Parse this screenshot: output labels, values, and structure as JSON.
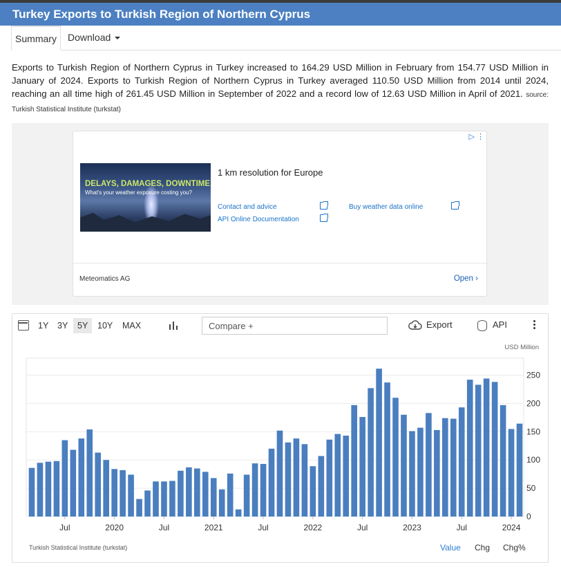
{
  "page": {
    "title": "Turkey Exports to Turkish Region of Northern Cyprus",
    "tabs": [
      {
        "label": "Summary"
      },
      {
        "label": "Download"
      }
    ],
    "description": "Exports to Turkish Region of Northern Cyprus in Turkey increased to 164.29 USD Million in February from 154.77 USD Million in January of 2024. Exports to Turkish Region of Northern Cyprus in Turkey averaged 110.50 USD Million from 2014 until 2024, reaching an all time high of 261.45 USD Million in September of 2022 and a record low of 12.63 USD Million in April of 2021.",
    "source_note": "source: Turkish Statistical Institute (turkstat)"
  },
  "ad": {
    "image_headline": "DELAYS, DAMAGES, DOWNTIME",
    "image_subline": "What's your weather exposure costing you?",
    "headline": "1 km resolution for Europe",
    "link1": "Contact and advice",
    "link2": "Buy weather data online",
    "link3": "API Online Documentation",
    "company": "Meteomatics AG",
    "open_label": "Open",
    "open_chevron": "›",
    "corner_icons": "▷ ⋮"
  },
  "toolbar": {
    "ranges": [
      "1Y",
      "3Y",
      "5Y",
      "10Y",
      "MAX"
    ],
    "selected_range": "5Y",
    "compare_placeholder": "Compare +",
    "export_label": "Export",
    "api_label": "API"
  },
  "footer": {
    "source": "Turkish Statistical Institute (turkstat)",
    "buttons": [
      "Value",
      "Chg",
      "Chg%"
    ],
    "active": "Value"
  },
  "colors": {
    "bar": "#4a7ebf",
    "title_bg": "#4c80c2",
    "active_link": "#2d7dd2"
  },
  "chart_data": {
    "type": "bar",
    "unit_label": "USD Million",
    "ylim": [
      0,
      280
    ],
    "yticks": [
      0,
      50,
      100,
      150,
      200,
      250
    ],
    "x_tick_labels": [
      {
        "label": "Jul",
        "index": 4
      },
      {
        "label": "2020",
        "index": 10
      },
      {
        "label": "Jul",
        "index": 16
      },
      {
        "label": "2021",
        "index": 22
      },
      {
        "label": "Jul",
        "index": 28
      },
      {
        "label": "2022",
        "index": 34
      },
      {
        "label": "Jul",
        "index": 40
      },
      {
        "label": "2023",
        "index": 46
      },
      {
        "label": "Jul",
        "index": 52
      },
      {
        "label": "2024",
        "index": 58
      }
    ],
    "periods": [
      "Mar 2019",
      "Apr 2019",
      "May 2019",
      "Jun 2019",
      "Jul 2019",
      "Aug 2019",
      "Sep 2019",
      "Oct 2019",
      "Nov 2019",
      "Dec 2019",
      "Jan 2020",
      "Feb 2020",
      "Mar 2020",
      "Apr 2020",
      "May 2020",
      "Jun 2020",
      "Jul 2020",
      "Aug 2020",
      "Sep 2020",
      "Oct 2020",
      "Nov 2020",
      "Dec 2020",
      "Jan 2021",
      "Feb 2021",
      "Mar 2021",
      "Apr 2021",
      "May 2021",
      "Jun 2021",
      "Jul 2021",
      "Aug 2021",
      "Sep 2021",
      "Oct 2021",
      "Nov 2021",
      "Dec 2021",
      "Jan 2022",
      "Feb 2022",
      "Mar 2022",
      "Apr 2022",
      "May 2022",
      "Jun 2022",
      "Jul 2022",
      "Aug 2022",
      "Sep 2022",
      "Oct 2022",
      "Nov 2022",
      "Dec 2022",
      "Jan 2023",
      "Feb 2023",
      "Mar 2023",
      "Apr 2023",
      "May 2023",
      "Jun 2023",
      "Jul 2023",
      "Aug 2023",
      "Sep 2023",
      "Oct 2023",
      "Nov 2023",
      "Dec 2023",
      "Jan 2024",
      "Feb 2024"
    ],
    "values": [
      86,
      95,
      97,
      98,
      135,
      118,
      138,
      154,
      113,
      100,
      84,
      82,
      74,
      31,
      46,
      62,
      62,
      63,
      81,
      87,
      85,
      79,
      68,
      48,
      76,
      12.63,
      74,
      94,
      93,
      120,
      152,
      131,
      138,
      128,
      89,
      107,
      136,
      146,
      143,
      197,
      176,
      227,
      261.45,
      237,
      210,
      180,
      151,
      157,
      183,
      153,
      174,
      173,
      193,
      242,
      233,
      244,
      238,
      197,
      154.77,
      164.29
    ]
  }
}
